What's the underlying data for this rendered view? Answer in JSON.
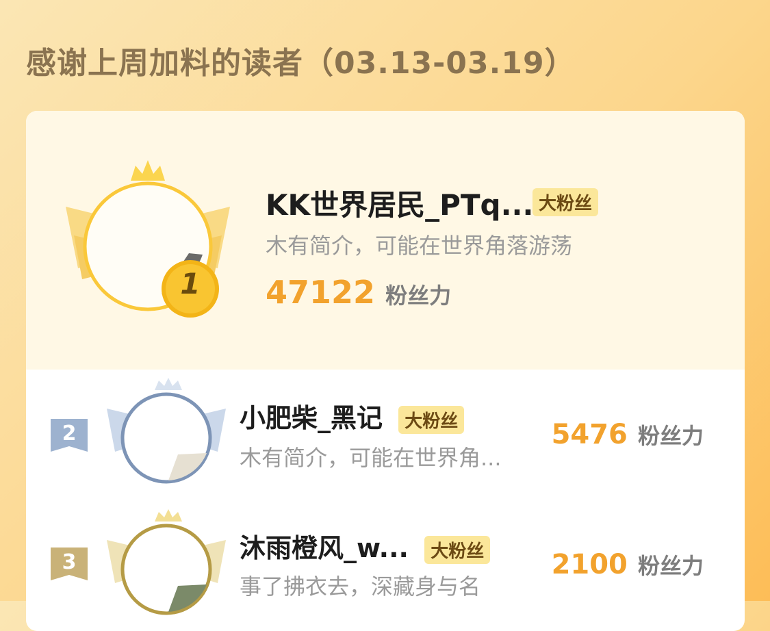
{
  "header": {
    "title": "感谢上周加料的读者（03.13-03.19）"
  },
  "leaderboard": [
    {
      "rank": "1",
      "name": "KK世界居民_PTq...",
      "badge": "大粉丝",
      "bio": "木有简介，可能在世界角落游荡",
      "score": "47122",
      "score_unit": "粉丝力"
    },
    {
      "rank": "2",
      "name": "小肥柴_黑记",
      "badge": "大粉丝",
      "bio": "木有简介，可能在世界角...",
      "score": "5476",
      "score_unit": "粉丝力"
    },
    {
      "rank": "3",
      "name": "沐雨橙风_w...",
      "badge": "大粉丝",
      "bio": "事了拂衣去，深藏身与名",
      "score": "2100",
      "score_unit": "粉丝力"
    }
  ],
  "colors": {
    "gold": "#f2a22d",
    "silver": "#9db2cf",
    "bronze": "#c9b278",
    "badge_bg": "#fbe79a"
  },
  "icons": {
    "first_rank_medal": "gold-medal-icon",
    "crown": "crown-icon",
    "wings": "laurel-wings-icon"
  }
}
